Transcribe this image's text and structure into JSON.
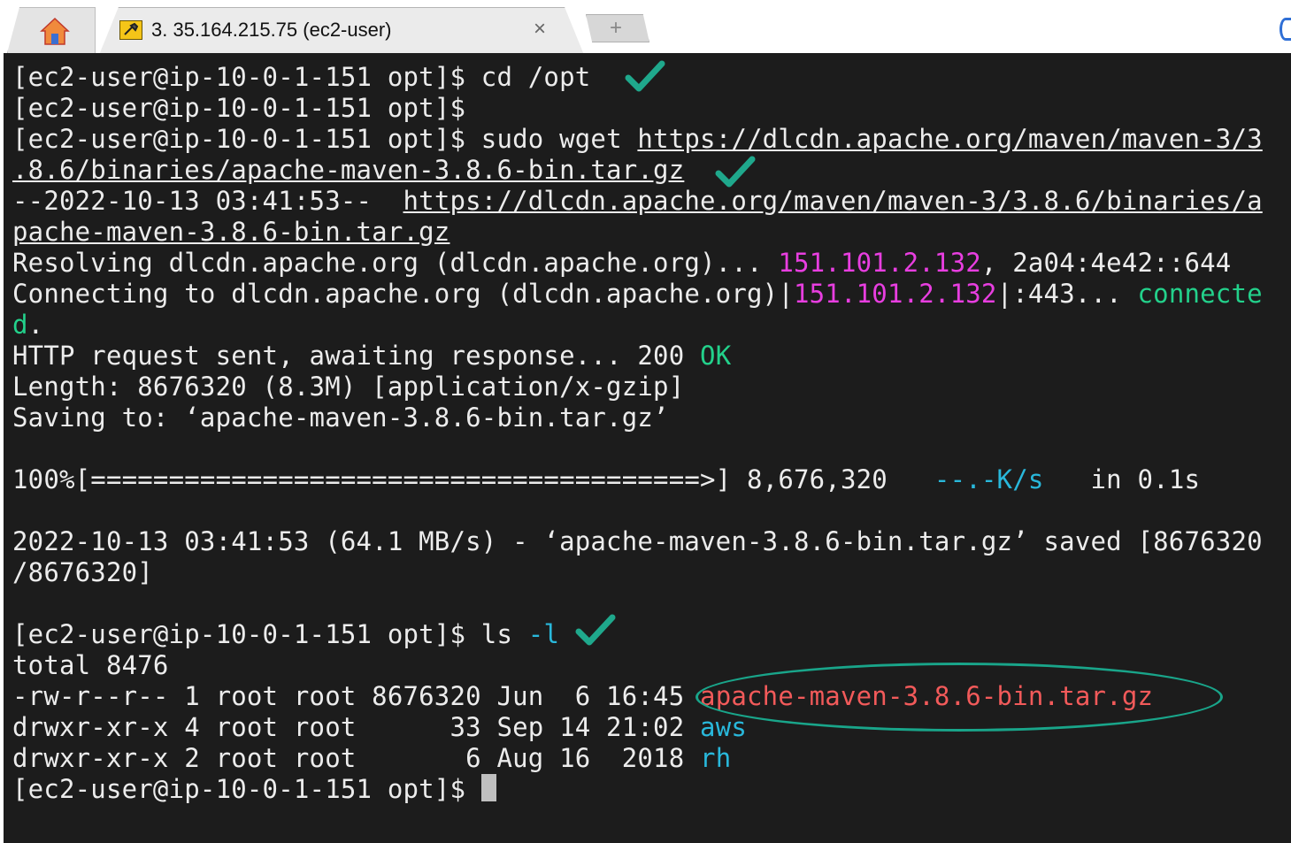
{
  "tabs": {
    "home_icon": "house-icon",
    "active_title": "3. 35.164.215.75 (ec2-user)",
    "close_label": "×",
    "new_tab_label": "+"
  },
  "terminal": {
    "prompt": "[ec2-user@ip-10-0-1-151 opt]$ ",
    "l1_cmd": "cd /opt",
    "l3_cmd": "sudo wget ",
    "l3_url": "https://dlcdn.apache.org/maven/maven-3/3",
    "l4_url": ".8.6/binaries/apache-maven-3.8.6-bin.tar.gz",
    "l5_pre": "--2022-10-13 03:41:53--  ",
    "l5_url": "https://dlcdn.apache.org/maven/maven-3/3.8.6/binaries/a",
    "l6_url": "pache-maven-3.8.6-bin.tar.gz",
    "l7_pre": "Resolving dlcdn.apache.org (dlcdn.apache.org)... ",
    "l7_ip": "151.101.2.132",
    "l7_post": ", 2a04:4e42::644",
    "l8_pre": "Connecting to dlcdn.apache.org (dlcdn.apache.org)|",
    "l8_ip": "151.101.2.132",
    "l8_mid": "|:443... ",
    "l8_status": "connecte",
    "l9_status": "d",
    "l9_post": ".",
    "l10_pre": "HTTP request sent, awaiting response... 200 ",
    "l10_ok": "OK",
    "l11": "Length: 8676320 (8.3M) [application/x-gzip]",
    "l12": "Saving to: ‘apache-maven-3.8.6-bin.tar.gz’",
    "l14_pre": "100%[=======================================>] 8,676,320   ",
    "l14_rate": "--.-K/s",
    "l14_post": "   in 0.1s",
    "l16": "2022-10-13 03:41:53 (64.1 MB/s) - ‘apache-maven-3.8.6-bin.tar.gz’ saved [8676320",
    "l17": "/8676320]",
    "l19_cmd": "ls ",
    "l19_flag": "-l",
    "l20": "total 8476",
    "l21_pre": "-rw-r--r-- 1 root root 8676320 Jun  6 16:45 ",
    "l21_file": "apache-maven-3.8.6-bin.tar.gz",
    "l22_pre": "drwxr-xr-x 4 root root      33 Sep 14 21:02 ",
    "l22_dir": "aws",
    "l23_pre": "drwxr-xr-x 2 root root       6 Aug 16  2018 ",
    "l23_dir": "rh"
  },
  "colors": {
    "background": "#1c1c1c",
    "text": "#ececec",
    "ip": "#e83ee0",
    "success": "#23d18b",
    "directory": "#29b8db",
    "archive": "#f25a5a",
    "annotation": "#19a58a"
  }
}
